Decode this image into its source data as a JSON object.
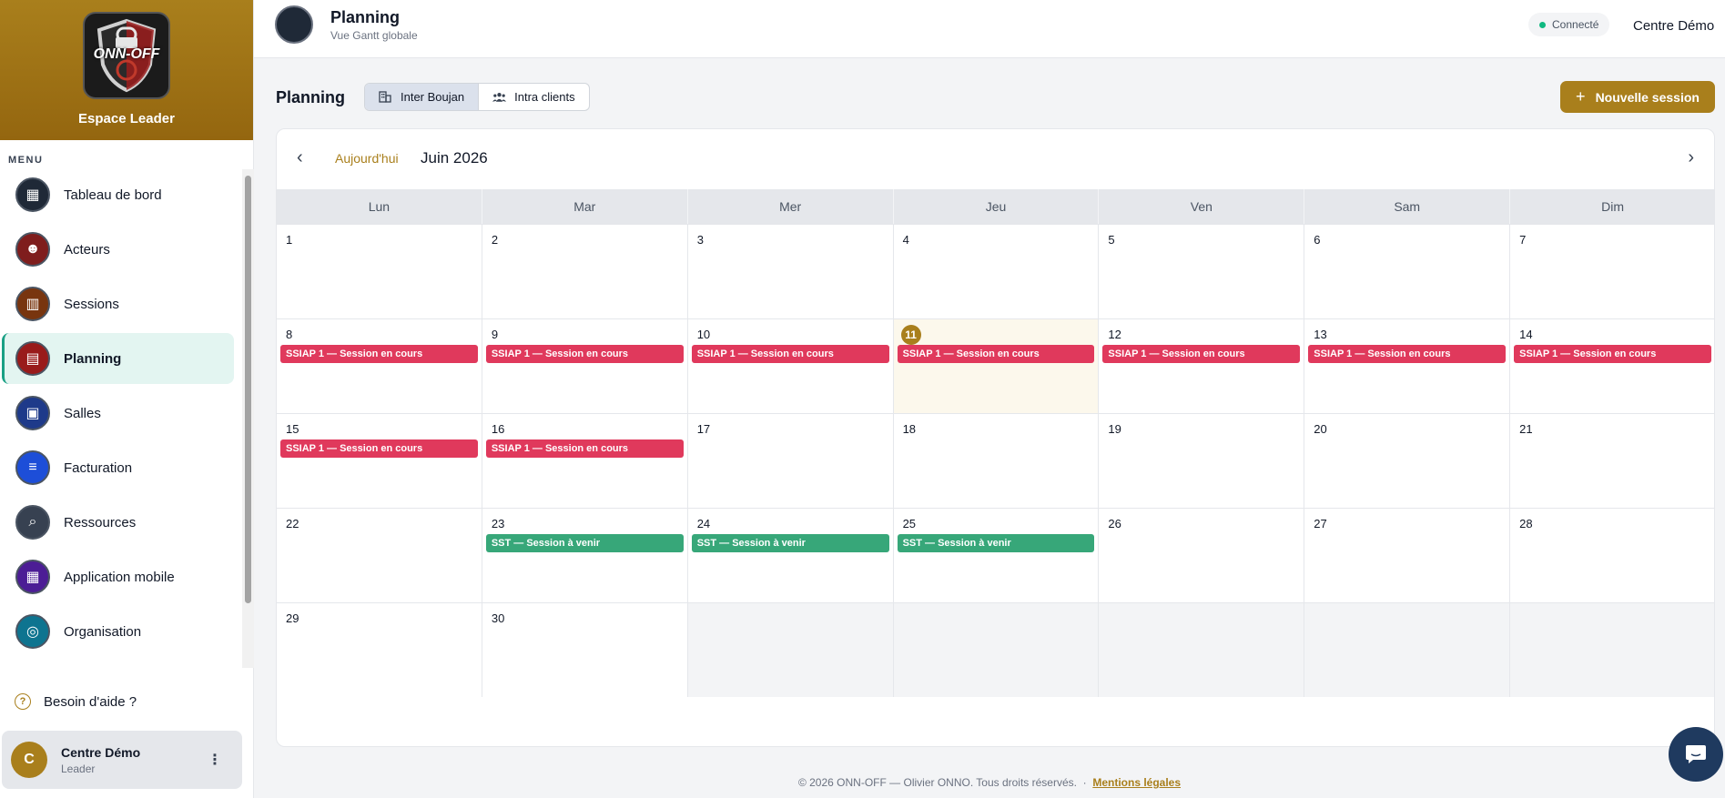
{
  "sidebar": {
    "brand_title": "Espace Leader",
    "logo_text": "ONN-OFF",
    "menu_label": "MENU",
    "items": [
      {
        "label": "Tableau de bord",
        "icon": "dashboard-icon",
        "active": false
      },
      {
        "label": "Acteurs",
        "icon": "actors-icon",
        "active": false
      },
      {
        "label": "Sessions",
        "icon": "sessions-icon",
        "active": false
      },
      {
        "label": "Planning",
        "icon": "planning-icon",
        "active": true
      },
      {
        "label": "Salles",
        "icon": "rooms-icon",
        "active": false
      },
      {
        "label": "Facturation",
        "icon": "billing-icon",
        "active": false
      },
      {
        "label": "Ressources",
        "icon": "resources-icon",
        "active": false
      },
      {
        "label": "Application mobile",
        "icon": "mobile-app-icon",
        "active": false
      },
      {
        "label": "Organisation",
        "icon": "organization-icon",
        "active": false
      }
    ],
    "help_label": "Besoin d'aide ?",
    "user": {
      "initial": "C",
      "name": "Centre Démo",
      "role": "Leader"
    }
  },
  "topbar": {
    "title": "Planning",
    "subtitle": "Vue Gantt globale",
    "status": "Connecté",
    "org": "Centre Démo"
  },
  "main": {
    "title": "Planning",
    "segments": [
      {
        "label": "Inter Boujan",
        "icon": "building-icon",
        "active": true
      },
      {
        "label": "Intra clients",
        "icon": "users-icon",
        "active": false
      }
    ],
    "new_session_label": "Nouvelle session"
  },
  "calendar": {
    "today_label": "Aujourd'hui",
    "month_label": "Juin 2026",
    "weekdays": [
      "Lun",
      "Mar",
      "Mer",
      "Jeu",
      "Ven",
      "Sam",
      "Dim"
    ],
    "today": 11,
    "weeks": [
      [
        {
          "d": "1"
        },
        {
          "d": "2"
        },
        {
          "d": "3"
        },
        {
          "d": "4"
        },
        {
          "d": "5"
        },
        {
          "d": "6"
        },
        {
          "d": "7"
        }
      ],
      [
        {
          "d": "8",
          "ev": "SSIAP 1 — Session en cours",
          "t": "red"
        },
        {
          "d": "9",
          "ev": "SSIAP 1 — Session en cours",
          "t": "red"
        },
        {
          "d": "10",
          "ev": "SSIAP 1 — Session en cours",
          "t": "red"
        },
        {
          "d": "11",
          "ev": "SSIAP 1 — Session en cours",
          "t": "red"
        },
        {
          "d": "12",
          "ev": "SSIAP 1 — Session en cours",
          "t": "red"
        },
        {
          "d": "13",
          "ev": "SSIAP 1 — Session en cours",
          "t": "red"
        },
        {
          "d": "14",
          "ev": "SSIAP 1 — Session en cours",
          "t": "red"
        }
      ],
      [
        {
          "d": "15",
          "ev": "SSIAP 1 — Session en cours",
          "t": "red"
        },
        {
          "d": "16",
          "ev": "SSIAP 1 — Session en cours",
          "t": "red"
        },
        {
          "d": "17"
        },
        {
          "d": "18"
        },
        {
          "d": "19"
        },
        {
          "d": "20"
        },
        {
          "d": "21"
        }
      ],
      [
        {
          "d": "22"
        },
        {
          "d": "23",
          "ev": "SST — Session à venir",
          "t": "green"
        },
        {
          "d": "24",
          "ev": "SST — Session à venir",
          "t": "green"
        },
        {
          "d": "25",
          "ev": "SST — Session à venir",
          "t": "green"
        },
        {
          "d": "26"
        },
        {
          "d": "27"
        },
        {
          "d": "28"
        }
      ],
      [
        {
          "d": "29"
        },
        {
          "d": "30"
        },
        {
          "d": ""
        },
        {
          "d": ""
        },
        {
          "d": ""
        },
        {
          "d": ""
        },
        {
          "d": ""
        }
      ]
    ]
  },
  "colors": {
    "accent": "#a97f1c",
    "event_red": "#e0395c",
    "event_green": "#37a779",
    "active_green": "#1aa085"
  },
  "footer": {
    "copyright": "© 2026 ONN-OFF — Olivier ONNO. Tous droits réservés.",
    "separator": "·",
    "legal_link": "Mentions légales"
  }
}
